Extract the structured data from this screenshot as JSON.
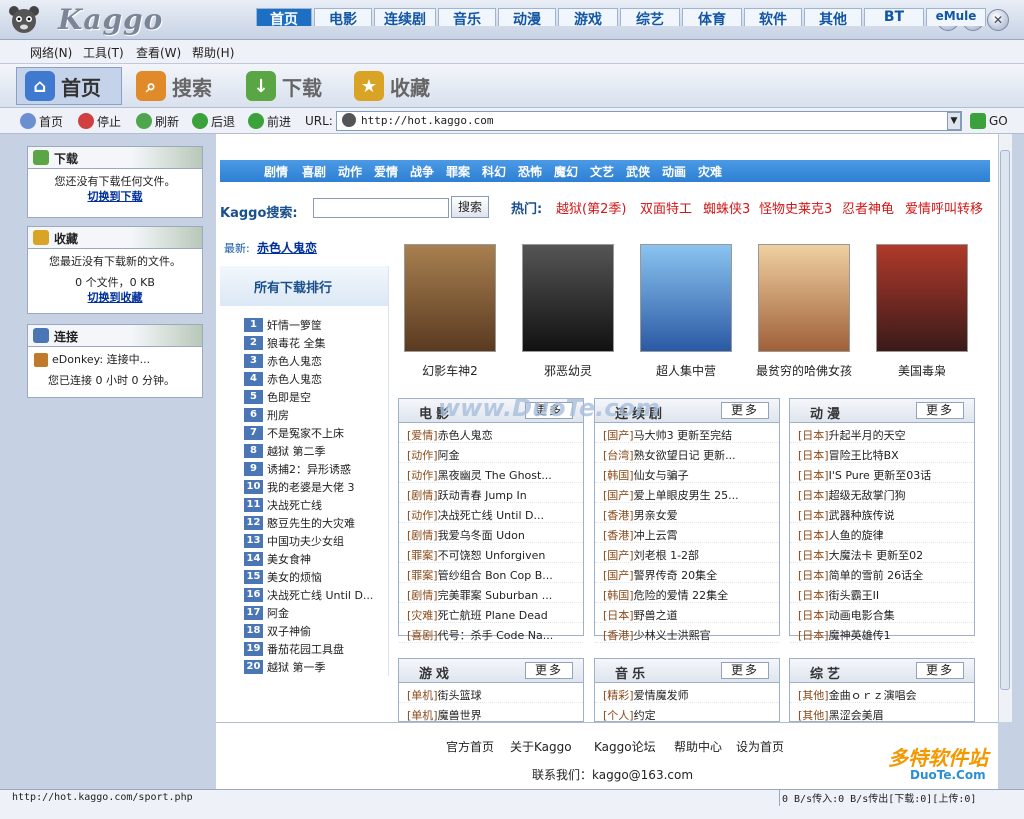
{
  "window": {
    "title": "Kaggo"
  },
  "menu": [
    "网络(N)",
    "工具(T)",
    "查看(W)",
    "帮助(H)"
  ],
  "nav": [
    "首页",
    "搜索",
    "下载",
    "收藏"
  ],
  "toolbar": {
    "home": "首页",
    "stop": "停止",
    "refresh": "刷新",
    "back": "后退",
    "forward": "前进",
    "url_label": "URL:",
    "url": "http://hot.kaggo.com",
    "go": "GO"
  },
  "panels": {
    "download": {
      "title": "下载",
      "text": "您还没有下载任何文件。",
      "link": "切换到下载"
    },
    "favorites": {
      "title": "收藏",
      "text": "您最近没有下载新的文件。",
      "count": "0 个文件，0 KB",
      "link": "切换到收藏"
    },
    "connect": {
      "title": "连接",
      "status": "eDonkey: 连接中...",
      "time": "您已连接 0 小时 0 分钟。"
    }
  },
  "categories": [
    "首页",
    "电影",
    "连续剧",
    "音乐",
    "动漫",
    "游戏",
    "综艺",
    "体育",
    "软件",
    "其他",
    "BT",
    "eMule"
  ],
  "subcategories": [
    "剧情",
    "喜剧",
    "动作",
    "爱情",
    "战争",
    "罪案",
    "科幻",
    "恐怖",
    "魔幻",
    "文艺",
    "武侠",
    "动画",
    "灾难"
  ],
  "search": {
    "label": "Kaggo搜索:",
    "button": "搜索",
    "hot_label": "热门:",
    "hot": [
      "越狱(第2季)",
      "双面特工",
      "蜘蛛侠3",
      "怪物史莱克3",
      "忍者神龟",
      "爱情呼叫转移"
    ]
  },
  "latest": {
    "label": "最新:",
    "title": "赤色人鬼恋"
  },
  "ranking": {
    "title": "所有下载排行",
    "items": [
      "奸情一箩筐",
      "狼毒花 全集",
      "赤色人鬼恋",
      "赤色人鬼恋",
      "色即是空",
      "刑房",
      "不是冤家不上床",
      "越狱 第二季",
      "诱捕2：异形诱惑",
      "我的老婆是大佬 3",
      "决战死亡线",
      "憨豆先生的大灾难",
      "中国功夫少女组",
      "美女食神",
      "美女的烦恼",
      "决战死亡线 Until D...",
      "阿金",
      "双子神偷",
      "番茄花园工具盘",
      "越狱 第一季"
    ]
  },
  "posters": [
    {
      "title": "幻影车神2",
      "color": "#7a5a3a"
    },
    {
      "title": "邪恶幼灵",
      "color": "#2a2a2a"
    },
    {
      "title": "超人集中营",
      "color": "#3a7ac4"
    },
    {
      "title": "最贫穷的哈佛女孩",
      "color": "#c48a5a"
    },
    {
      "title": "美国毒枭",
      "color": "#7a2a2a"
    }
  ],
  "watermark": "www.DuoTe.com",
  "boxes": {
    "movie": {
      "title": "电影",
      "more": "更多",
      "items": [
        [
          "[爱情]",
          "赤色人鬼恋"
        ],
        [
          "[动作]",
          "阿金"
        ],
        [
          "[动作]",
          "黑夜幽灵 The Ghost..."
        ],
        [
          "[剧情]",
          "跃动青春 Jump In"
        ],
        [
          "[动作]",
          "决战死亡线 Until D..."
        ],
        [
          "[剧情]",
          "我爱乌冬面 Udon"
        ],
        [
          "[罪案]",
          "不可饶恕 Unforgiven"
        ],
        [
          "[罪案]",
          "管纱组合 Bon Cop B..."
        ],
        [
          "[剧情]",
          "完美罪案 Suburban ..."
        ],
        [
          "[灾难]",
          "死亡航班 Plane Dead"
        ],
        [
          "[喜剧]",
          "代号：杀手 Code Na..."
        ]
      ]
    },
    "series": {
      "title": "连续剧",
      "more": "更多",
      "items": [
        [
          "[国产]",
          "马大帅3 更新至完结"
        ],
        [
          "[台湾]",
          "熟女欲望日记 更新..."
        ],
        [
          "[韩国]",
          "仙女与骗子"
        ],
        [
          "[国产]",
          "爱上单眼皮男生 25..."
        ],
        [
          "[香港]",
          "男亲女爱"
        ],
        [
          "[香港]",
          "冲上云霄"
        ],
        [
          "[国产]",
          "刘老根 1-2部"
        ],
        [
          "[国产]",
          "警界传奇 20集全"
        ],
        [
          "[韩国]",
          "危险的爱情 22集全"
        ],
        [
          "[日本]",
          "野兽之道"
        ],
        [
          "[香港]",
          "少林义士洪熙官"
        ]
      ]
    },
    "anime": {
      "title": "动漫",
      "more": "更多",
      "items": [
        [
          "[日本]",
          "升起半月的天空"
        ],
        [
          "[日本]",
          "冒险王比特BX"
        ],
        [
          "[日本]",
          "I'S Pure 更新至03话"
        ],
        [
          "[日本]",
          "超级无敌掌门狗"
        ],
        [
          "[日本]",
          "武器种族传说"
        ],
        [
          "[日本]",
          "人鱼的旋律"
        ],
        [
          "[日本]",
          "大魔法卡 更新至02"
        ],
        [
          "[日本]",
          "简单的雪前 26话全"
        ],
        [
          "[日本]",
          "街头霸王II"
        ],
        [
          "[日本]",
          "动画电影合集"
        ],
        [
          "[日本]",
          "魔神英雄传1"
        ]
      ]
    },
    "game": {
      "title": "游戏",
      "more": "更多",
      "items": [
        [
          "[单机]",
          "街头篮球"
        ],
        [
          "[单机]",
          "魔兽世界"
        ]
      ]
    },
    "music": {
      "title": "音乐",
      "more": "更多",
      "items": [
        [
          "[精彩]",
          "爱情魔发师"
        ],
        [
          "[个人]",
          "约定"
        ]
      ]
    },
    "variety": {
      "title": "综艺",
      "more": "更多",
      "items": [
        [
          "[其他]",
          "金曲ｏｒｚ演唱会"
        ],
        [
          "[其他]",
          "黑涩会美眉"
        ]
      ]
    }
  },
  "footer": {
    "links": [
      "官方首页",
      "关于Kaggo",
      "Kaggo论坛",
      "帮助中心",
      "设为首页"
    ],
    "contact": "联系我们：kaggo@163.com"
  },
  "status": {
    "url": "http://hot.kaggo.com/sport.php",
    "rate": "0 B/s传入:0 B/s传出[下载:0][上传:0]"
  },
  "brand_watermark": {
    "main": "多特软件站",
    "sub": "DuoTe.Com"
  }
}
